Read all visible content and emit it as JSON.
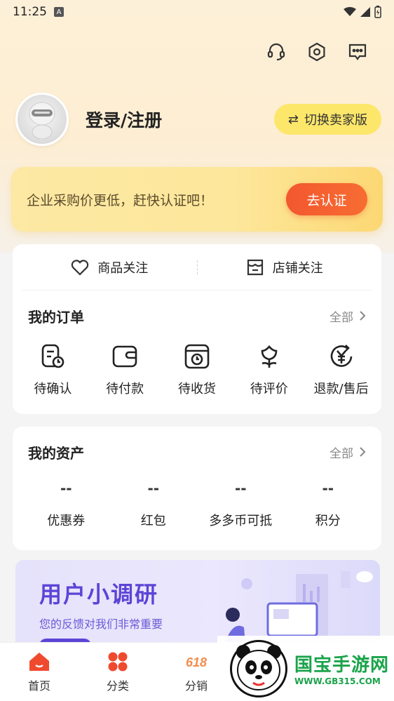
{
  "status_bar": {
    "time": "11:25",
    "notif_icon": "A"
  },
  "header": {
    "login_text": "登录/注册",
    "switch_label": "切换卖家版",
    "switch_icon": "⇄"
  },
  "cert_banner": {
    "text": "企业采购价更低，赶快认证吧！",
    "button": "去认证"
  },
  "follow": {
    "products": "商品关注",
    "shops": "店铺关注"
  },
  "orders": {
    "title": "我的订单",
    "more": "全部",
    "items": [
      {
        "label": "待确认",
        "icon": "confirm-icon"
      },
      {
        "label": "待付款",
        "icon": "wallet-icon"
      },
      {
        "label": "待收货",
        "icon": "package-icon"
      },
      {
        "label": "待评价",
        "icon": "flower-icon"
      },
      {
        "label": "退款/售后",
        "icon": "refund-icon"
      }
    ]
  },
  "assets": {
    "title": "我的资产",
    "more": "全部",
    "items": [
      {
        "value": "--",
        "label": "优惠券"
      },
      {
        "value": "--",
        "label": "红包"
      },
      {
        "value": "--",
        "label": "多多币可抵"
      },
      {
        "value": "--",
        "label": "积分"
      }
    ]
  },
  "survey": {
    "title": "用户小调研",
    "subtitle": "您的反馈对我们非常重要"
  },
  "tabs": [
    {
      "label": "首页",
      "icon": "home-icon"
    },
    {
      "label": "分类",
      "icon": "category-icon"
    },
    {
      "label": "分销",
      "icon": "618-icon"
    }
  ],
  "watermark": {
    "name": "国宝手游网",
    "url": "WWW.GB315.COM"
  },
  "colors": {
    "accent_orange": "#f3572f",
    "switch_yellow": "#fde76b",
    "survey_purple": "#5c44d6",
    "tab_red": "#f04a2e"
  }
}
